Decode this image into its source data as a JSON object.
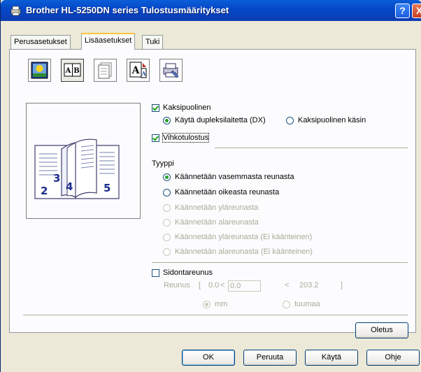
{
  "window": {
    "title": "Brother HL-5250DN series Tulostusmääritykset",
    "help_label": "?",
    "close_label": "X"
  },
  "tabs": [
    {
      "label": "Perusasetukset",
      "active": false
    },
    {
      "label": "Lisäasetukset",
      "active": true
    },
    {
      "label": "Tuki",
      "active": false
    }
  ],
  "toolbar_icons": [
    "watermark-icon",
    "duplex-icon",
    "copy-icon",
    "page-setting-icon",
    "device-options-icon"
  ],
  "toolbar_icon_labels": {
    "duplex": "A|B",
    "copy": "Copy",
    "page_setting": "A"
  },
  "preview": {
    "page_numbers": [
      "2",
      "3",
      "4",
      "5"
    ]
  },
  "duplex": {
    "label": "Kaksipuolinen",
    "checked": true,
    "option_device": "Käytä dupleksilaitetta (DX)",
    "option_manual": "Kaksipuolinen käsin",
    "selected": "device"
  },
  "booklet": {
    "label": "Vihkotulostus",
    "checked": true
  },
  "type": {
    "heading": "Tyyppi",
    "options": [
      {
        "label": "Käännetään vasemmasta reunasta",
        "enabled": true,
        "selected": true
      },
      {
        "label": "Käännetään oikeasta reunasta",
        "enabled": true,
        "selected": false
      },
      {
        "label": "Käännetään yläreunasta",
        "enabled": false,
        "selected": false
      },
      {
        "label": "Käännetään alareunasta",
        "enabled": false,
        "selected": false
      },
      {
        "label": "Käännetään yläreunasta (Ei käänteinen)",
        "enabled": false,
        "selected": false
      },
      {
        "label": "Käännetään alareunasta (Ei käänteinen)",
        "enabled": false,
        "selected": false
      }
    ]
  },
  "binding_offset": {
    "label": "Sidontareunus",
    "checked": false,
    "range_label": "Reunus",
    "bracket_open": "[",
    "less_than": "<",
    "min": "0.0",
    "value": "0.0",
    "max": "203.2",
    "bracket_close": "]",
    "unit_mm": "mm",
    "unit_inch": "tuumaa",
    "unit_selected": "mm"
  },
  "buttons": {
    "default": "Oletus",
    "ok": "OK",
    "cancel": "Peruuta",
    "apply": "Käytä",
    "help": "Ohje"
  },
  "colors": {
    "title_bar": "#0548c8",
    "check_mark": "#21a121",
    "disabled_text": "#aca899",
    "tab_highlight": "#ffc83c"
  }
}
